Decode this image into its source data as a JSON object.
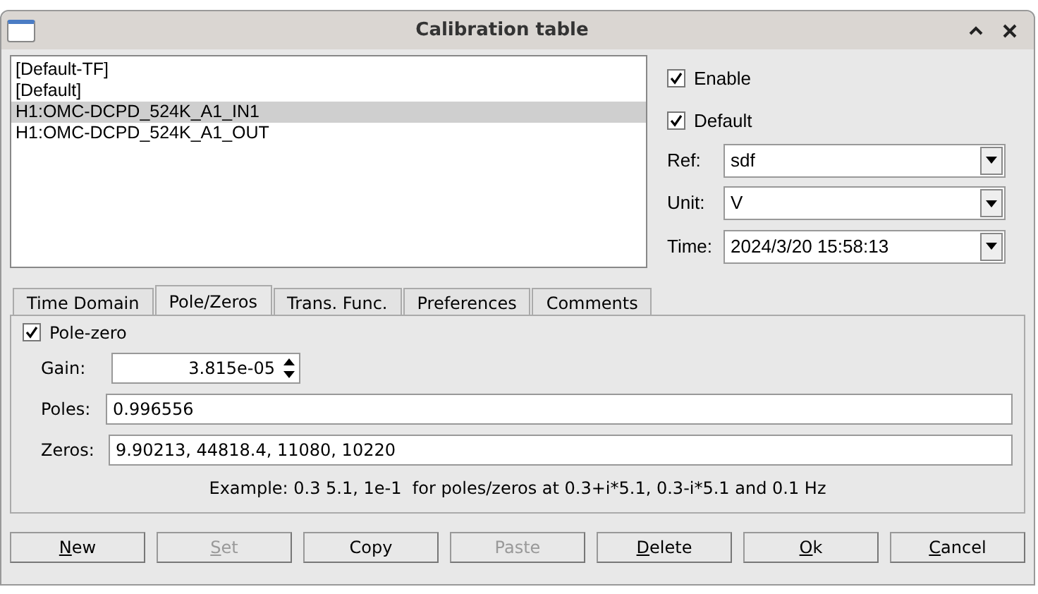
{
  "window": {
    "title": "Calibration table"
  },
  "channels": [
    {
      "label": "[Default-TF]",
      "selected": false
    },
    {
      "label": "[Default]",
      "selected": false
    },
    {
      "label": "H1:OMC-DCPD_524K_A1_IN1",
      "selected": true
    },
    {
      "label": "H1:OMC-DCPD_524K_A1_OUT",
      "selected": false
    }
  ],
  "options": [
    {
      "label": "Enable",
      "checked": true
    },
    {
      "label": "Default",
      "checked": true
    }
  ],
  "fields": [
    {
      "label": "Ref:",
      "value": "sdf"
    },
    {
      "label": "Unit:",
      "value": "V"
    },
    {
      "label": "Time:",
      "value": "2024/3/20 15:58:13"
    }
  ],
  "tabs": [
    {
      "label": "Time Domain",
      "selected": false
    },
    {
      "label": "Pole/Zeros",
      "selected": true
    },
    {
      "label": "Trans. Func.",
      "selected": false
    },
    {
      "label": "Preferences",
      "selected": false
    },
    {
      "label": "Comments",
      "selected": false
    }
  ],
  "pole_zero": {
    "label": "Pole-zero",
    "checked": true,
    "gain_label": "Gain:",
    "gain": "3.815e-05",
    "poles_label": "Poles:",
    "poles": "0.996556",
    "zeros_label": "Zeros:",
    "zeros": "9.90213, 44818.4, 11080, 10220",
    "example": "Example: 0.3 5.1, 1e-1  for poles/zeros at 0.3+i*5.1, 0.3-i*5.1 and 0.1 Hz"
  },
  "buttons": [
    {
      "label": "New",
      "disabled": false,
      "mnemonic": true
    },
    {
      "label": "Set",
      "disabled": true,
      "mnemonic": true
    },
    {
      "label": "Copy",
      "disabled": false,
      "mnemonic": false
    },
    {
      "label": "Paste",
      "disabled": true,
      "mnemonic": false
    },
    {
      "label": "Delete",
      "disabled": false,
      "mnemonic": true
    },
    {
      "label": "Ok",
      "disabled": false,
      "mnemonic": true
    },
    {
      "label": "Cancel",
      "disabled": false,
      "mnemonic": true
    }
  ]
}
